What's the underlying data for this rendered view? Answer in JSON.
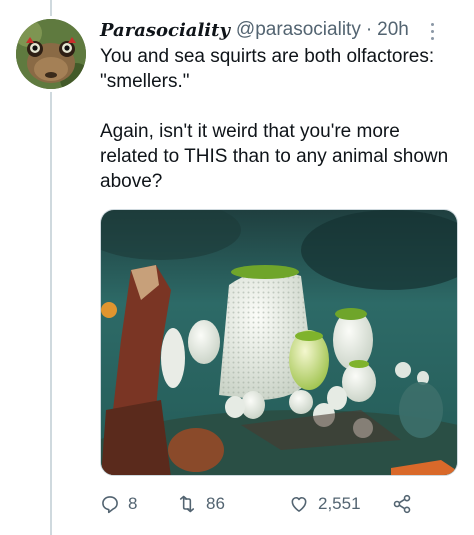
{
  "author": {
    "display_name": "Parasociality",
    "handle": "@parasociality",
    "separator": "·",
    "time": "20h"
  },
  "tweet": {
    "paragraphs": [
      "You and sea squirts are both olfactores: \"smellers.\"",
      "Again, isn't it weird that you're more related to THIS than to any animal shown above?"
    ]
  },
  "media": {
    "icon": "sea-squirt-photo",
    "colors": {
      "water": "#2c6a66",
      "squirt": "#eef1ea",
      "green_rim": "#7cb52a",
      "coral": "#8a3a25"
    }
  },
  "actions": {
    "replies": "8",
    "retweets": "86",
    "likes": "2,551",
    "icons": [
      "reply-icon",
      "retweet-icon",
      "like-icon",
      "share-icon"
    ]
  },
  "colors": {
    "text": "#0f1419",
    "muted": "#536471",
    "border": "#cfd9de"
  }
}
